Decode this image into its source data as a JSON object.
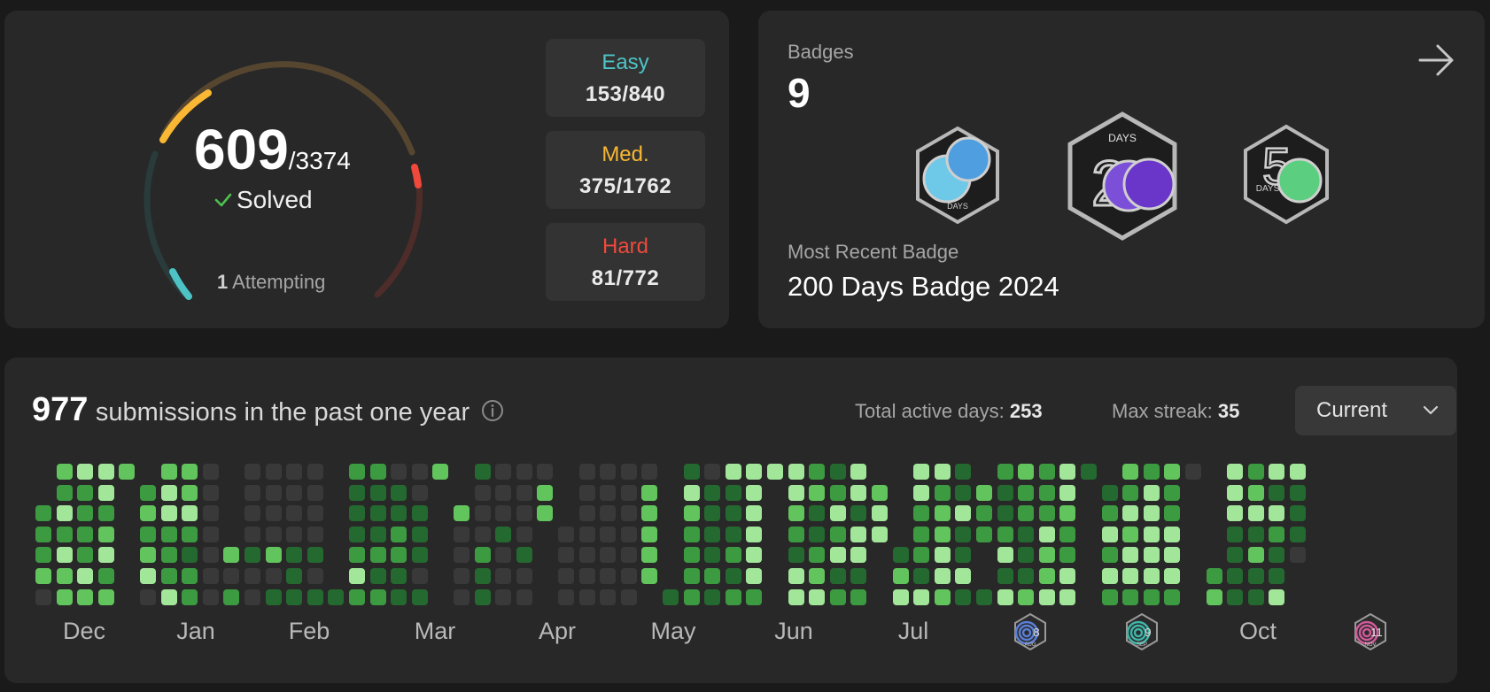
{
  "progress": {
    "solved": "609",
    "total": "/3374",
    "solved_label": "Solved",
    "attempting_count": "1",
    "attempting_label": "Attempting",
    "difficulty": [
      {
        "label": "Easy",
        "value": "153/840",
        "color": "#4ec3c6"
      },
      {
        "label": "Med.",
        "value": "375/1762",
        "color": "#f9b733"
      },
      {
        "label": "Hard",
        "value": "81/772",
        "color": "#f0493b"
      }
    ]
  },
  "badges": {
    "title": "Badges",
    "count": "9",
    "recent_label": "Most Recent Badge",
    "recent_name": "200 Days Badge 2024",
    "items": [
      {
        "name": "100-days-badge",
        "label": "DAYS"
      },
      {
        "name": "200-days-badge",
        "label": "DAYS"
      },
      {
        "name": "50-days-badge",
        "label": "DAYS"
      }
    ]
  },
  "submissions": {
    "count": "977",
    "label": "submissions in the past one year",
    "active_days_label": "Total active days:",
    "active_days": "253",
    "max_streak_label": "Max streak:",
    "max_streak": "35",
    "dropdown_value": "Current",
    "months": [
      {
        "type": "text",
        "label": "Dec"
      },
      {
        "type": "text",
        "label": "Jan"
      },
      {
        "type": "text",
        "label": "Feb"
      },
      {
        "type": "text",
        "label": "Mar"
      },
      {
        "type": "text",
        "label": "Apr"
      },
      {
        "type": "text",
        "label": "May"
      },
      {
        "type": "text",
        "label": "Jun"
      },
      {
        "type": "text",
        "label": "Jul"
      },
      {
        "type": "badge",
        "label": "8",
        "sub": "AUG",
        "color": "#5a7fd6"
      },
      {
        "type": "badge",
        "label": "9",
        "sub": "SEP",
        "color": "#3fb5a8"
      },
      {
        "type": "text",
        "label": "Oct"
      },
      {
        "type": "badge",
        "label": "11",
        "sub": "NOV",
        "color": "#d05a9a"
      }
    ],
    "heatmap_colors": [
      "#393939",
      "#24692f",
      "#3c9a41",
      "#62c45c",
      "#a2e69a"
    ],
    "heatmap": [
      [
        -1,
        -1,
        2,
        2,
        2,
        3,
        0
      ],
      [
        3,
        2,
        4,
        2,
        4,
        3,
        3
      ],
      [
        4,
        2,
        2,
        2,
        2,
        4,
        3
      ],
      [
        4,
        4,
        2,
        3,
        4,
        2,
        3
      ],
      [
        3,
        -1,
        -1,
        -1,
        -1,
        -1,
        -1
      ],
      [
        -1,
        2,
        3,
        2,
        3,
        4,
        0
      ],
      [
        3,
        4,
        4,
        2,
        2,
        2,
        4
      ],
      [
        3,
        3,
        4,
        2,
        1,
        2,
        2
      ],
      [
        0,
        0,
        0,
        0,
        0,
        0,
        0
      ],
      [
        -1,
        -1,
        -1,
        -1,
        3,
        0,
        2
      ],
      [
        0,
        0,
        0,
        0,
        1,
        0,
        0
      ],
      [
        0,
        0,
        0,
        0,
        3,
        0,
        1
      ],
      [
        0,
        0,
        0,
        0,
        1,
        1,
        1
      ],
      [
        0,
        0,
        0,
        0,
        1,
        0,
        1
      ],
      [
        -1,
        -1,
        -1,
        -1,
        -1,
        -1,
        1
      ],
      [
        2,
        1,
        1,
        1,
        2,
        4,
        2
      ],
      [
        2,
        1,
        1,
        1,
        2,
        1,
        2
      ],
      [
        0,
        1,
        1,
        2,
        2,
        1,
        1
      ],
      [
        0,
        0,
        1,
        1,
        1,
        0,
        1
      ],
      [
        3,
        -1,
        -1,
        -1,
        -1,
        -1,
        -1
      ],
      [
        -1,
        -1,
        3,
        0,
        0,
        0,
        0
      ],
      [
        1,
        0,
        0,
        0,
        2,
        1,
        1
      ],
      [
        0,
        0,
        0,
        1,
        0,
        0,
        0
      ],
      [
        0,
        0,
        0,
        0,
        1,
        0,
        0
      ],
      [
        0,
        3,
        3,
        -1,
        -1,
        -1,
        -1
      ],
      [
        -1,
        -1,
        -1,
        0,
        0,
        0,
        0
      ],
      [
        0,
        0,
        0,
        0,
        0,
        0,
        0
      ],
      [
        0,
        0,
        0,
        0,
        0,
        0,
        0
      ],
      [
        0,
        0,
        0,
        0,
        0,
        0,
        0
      ],
      [
        0,
        3,
        3,
        3,
        3,
        3,
        -1
      ],
      [
        -1,
        -1,
        -1,
        -1,
        -1,
        -1,
        1
      ],
      [
        1,
        4,
        3,
        2,
        2,
        2,
        2
      ],
      [
        0,
        1,
        1,
        1,
        1,
        2,
        1
      ],
      [
        4,
        1,
        1,
        1,
        2,
        1,
        2
      ],
      [
        4,
        4,
        4,
        4,
        4,
        4,
        2
      ],
      [
        4,
        -1,
        -1,
        -1,
        -1,
        -1,
        -1
      ],
      [
        4,
        4,
        3,
        2,
        1,
        4,
        4
      ],
      [
        2,
        3,
        1,
        1,
        2,
        3,
        4
      ],
      [
        1,
        2,
        4,
        2,
        4,
        1,
        2
      ],
      [
        4,
        4,
        1,
        4,
        4,
        1,
        2
      ],
      [
        -1,
        3,
        4,
        4,
        -1,
        -1,
        -1
      ],
      [
        -1,
        -1,
        -1,
        -1,
        1,
        3,
        4
      ],
      [
        4,
        4,
        2,
        2,
        2,
        1,
        4
      ],
      [
        4,
        2,
        3,
        3,
        4,
        4,
        3
      ],
      [
        1,
        1,
        4,
        1,
        1,
        4,
        1
      ],
      [
        -1,
        3,
        2,
        2,
        -1,
        -1,
        1
      ],
      [
        2,
        1,
        1,
        2,
        4,
        1,
        4
      ],
      [
        3,
        2,
        2,
        1,
        1,
        1,
        3
      ],
      [
        2,
        2,
        2,
        4,
        3,
        3,
        4
      ],
      [
        4,
        4,
        3,
        2,
        2,
        4,
        4
      ],
      [
        1,
        -1,
        -1,
        -1,
        -1,
        -1,
        -1
      ],
      [
        -1,
        1,
        2,
        4,
        2,
        4,
        2
      ],
      [
        3,
        2,
        4,
        3,
        4,
        4,
        2
      ],
      [
        2,
        4,
        4,
        4,
        4,
        4,
        2
      ],
      [
        3,
        2,
        2,
        4,
        4,
        4,
        2
      ],
      [
        0,
        -1,
        -1,
        -1,
        -1,
        -1,
        -1
      ],
      [
        -1,
        -1,
        -1,
        -1,
        -1,
        2,
        3
      ],
      [
        4,
        4,
        4,
        1,
        1,
        1,
        1
      ],
      [
        2,
        3,
        4,
        1,
        3,
        1,
        1
      ],
      [
        4,
        1,
        4,
        2,
        1,
        1,
        4
      ],
      [
        4,
        1,
        1,
        1,
        0,
        -1,
        -1
      ]
    ]
  }
}
